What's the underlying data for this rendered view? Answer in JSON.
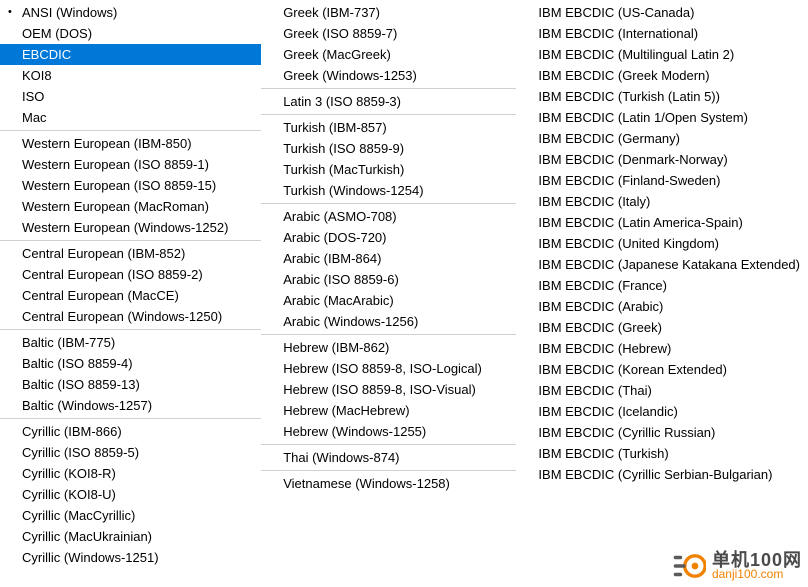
{
  "col1": {
    "groups": [
      [
        {
          "label": "ANSI (Windows)",
          "bullet": true,
          "selected": false
        },
        {
          "label": "OEM (DOS)",
          "bullet": false,
          "selected": false
        },
        {
          "label": "EBCDIC",
          "bullet": false,
          "selected": true
        },
        {
          "label": "KOI8",
          "bullet": false,
          "selected": false
        },
        {
          "label": "ISO",
          "bullet": false,
          "selected": false
        },
        {
          "label": "Mac",
          "bullet": false,
          "selected": false
        }
      ],
      [
        {
          "label": "Western European (IBM-850)"
        },
        {
          "label": "Western European (ISO 8859-1)"
        },
        {
          "label": "Western European (ISO 8859-15)"
        },
        {
          "label": "Western European (MacRoman)"
        },
        {
          "label": "Western European (Windows-1252)"
        }
      ],
      [
        {
          "label": "Central European (IBM-852)"
        },
        {
          "label": "Central European (ISO 8859-2)"
        },
        {
          "label": "Central European (MacCE)"
        },
        {
          "label": "Central European (Windows-1250)"
        }
      ],
      [
        {
          "label": "Baltic (IBM-775)"
        },
        {
          "label": "Baltic (ISO 8859-4)"
        },
        {
          "label": "Baltic (ISO 8859-13)"
        },
        {
          "label": "Baltic (Windows-1257)"
        }
      ],
      [
        {
          "label": "Cyrillic (IBM-866)"
        },
        {
          "label": "Cyrillic (ISO 8859-5)"
        },
        {
          "label": "Cyrillic (KOI8-R)"
        },
        {
          "label": "Cyrillic (KOI8-U)"
        },
        {
          "label": "Cyrillic (MacCyrillic)"
        },
        {
          "label": "Cyrillic (MacUkrainian)"
        },
        {
          "label": "Cyrillic (Windows-1251)"
        }
      ]
    ]
  },
  "col2": {
    "groups": [
      [
        {
          "label": "Greek (IBM-737)"
        },
        {
          "label": "Greek (ISO 8859-7)"
        },
        {
          "label": "Greek (MacGreek)"
        },
        {
          "label": "Greek (Windows-1253)"
        }
      ],
      [
        {
          "label": "Latin 3 (ISO 8859-3)"
        }
      ],
      [
        {
          "label": "Turkish (IBM-857)"
        },
        {
          "label": "Turkish (ISO 8859-9)"
        },
        {
          "label": "Turkish (MacTurkish)"
        },
        {
          "label": "Turkish (Windows-1254)"
        }
      ],
      [
        {
          "label": "Arabic (ASMO-708)"
        },
        {
          "label": "Arabic (DOS-720)"
        },
        {
          "label": "Arabic (IBM-864)"
        },
        {
          "label": "Arabic (ISO 8859-6)"
        },
        {
          "label": "Arabic (MacArabic)"
        },
        {
          "label": "Arabic (Windows-1256)"
        }
      ],
      [
        {
          "label": "Hebrew (IBM-862)"
        },
        {
          "label": "Hebrew (ISO 8859-8, ISO-Logical)"
        },
        {
          "label": "Hebrew (ISO 8859-8, ISO-Visual)"
        },
        {
          "label": "Hebrew (MacHebrew)"
        },
        {
          "label": "Hebrew (Windows-1255)"
        }
      ],
      [
        {
          "label": "Thai (Windows-874)"
        }
      ],
      [
        {
          "label": "Vietnamese (Windows-1258)"
        }
      ]
    ]
  },
  "col3": {
    "groups": [
      [
        {
          "label": "IBM EBCDIC (US-Canada)"
        },
        {
          "label": "IBM EBCDIC (International)"
        },
        {
          "label": "IBM EBCDIC (Multilingual Latin 2)"
        },
        {
          "label": "IBM EBCDIC (Greek Modern)"
        },
        {
          "label": "IBM EBCDIC (Turkish (Latin 5))"
        },
        {
          "label": "IBM EBCDIC (Latin 1/Open System)"
        },
        {
          "label": "IBM EBCDIC (Germany)"
        },
        {
          "label": "IBM EBCDIC (Denmark-Norway)"
        },
        {
          "label": "IBM EBCDIC (Finland-Sweden)"
        },
        {
          "label": "IBM EBCDIC (Italy)"
        },
        {
          "label": "IBM EBCDIC (Latin America-Spain)"
        },
        {
          "label": "IBM EBCDIC (United Kingdom)"
        },
        {
          "label": "IBM EBCDIC (Japanese Katakana Extended)"
        },
        {
          "label": "IBM EBCDIC (France)"
        },
        {
          "label": "IBM EBCDIC (Arabic)"
        },
        {
          "label": "IBM EBCDIC (Greek)"
        },
        {
          "label": "IBM EBCDIC (Hebrew)"
        },
        {
          "label": "IBM EBCDIC (Korean Extended)"
        },
        {
          "label": "IBM EBCDIC (Thai)"
        },
        {
          "label": "IBM EBCDIC (Icelandic)"
        },
        {
          "label": "IBM EBCDIC (Cyrillic Russian)"
        },
        {
          "label": "IBM EBCDIC (Turkish)"
        },
        {
          "label": "IBM EBCDIC (Cyrillic Serbian-Bulgarian)"
        }
      ]
    ]
  },
  "watermark": {
    "line1": "单机100网",
    "line2": "danji100.com"
  }
}
